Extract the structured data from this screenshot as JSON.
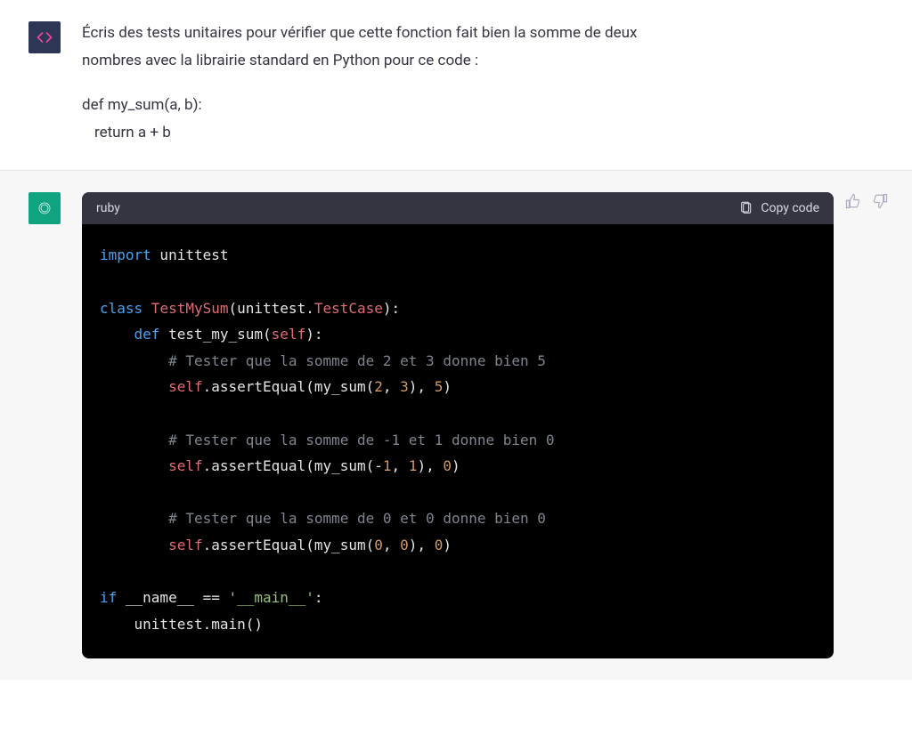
{
  "user_message": {
    "line1": "Écris des tests unitaires pour vérifier que cette fonction fait bien la somme de deux",
    "line2": "nombres avec la librairie standard en Python pour ce code :",
    "code_line1": "def my_sum(a, b):",
    "code_line2": "return a + b"
  },
  "assistant": {
    "code_header": {
      "language": "ruby",
      "copy_label": "Copy code"
    },
    "code": {
      "l1_import": "import",
      "l1_mod": " unittest",
      "l3_class": "class",
      "l3_name": " TestMySum",
      "l3_paren_a": "(unittest.",
      "l3_tc": "TestCase",
      "l3_paren_b": "):",
      "l4_def": "def",
      "l4_name": " test_my_sum",
      "l4_self_a": "(",
      "l4_self": "self",
      "l4_self_b": "):",
      "l5_cmt": "# Tester que la somme de 2 et 3 donne bien 5",
      "l6_self": "self",
      "l6_call": ".assertEqual(my_sum(",
      "l6_n1": "2",
      "l6_c": ", ",
      "l6_n2": "3",
      "l6_mid": "), ",
      "l6_n3": "5",
      "l6_end": ")",
      "l8_cmt": "# Tester que la somme de -1 et 1 donne bien 0",
      "l9_self": "self",
      "l9_call": ".assertEqual(my_sum(-",
      "l9_n1": "1",
      "l9_c": ", ",
      "l9_n2": "1",
      "l9_mid": "), ",
      "l9_n3": "0",
      "l9_end": ")",
      "l11_cmt": "# Tester que la somme de 0 et 0 donne bien 0",
      "l12_self": "self",
      "l12_call": ".assertEqual(my_sum(",
      "l12_n1": "0",
      "l12_c": ", ",
      "l12_n2": "0",
      "l12_mid": "), ",
      "l12_n3": "0",
      "l12_end": ")",
      "l14_if": "if",
      "l14_name": " __name__ == ",
      "l14_str": "'__main__'",
      "l14_colon": ":",
      "l15_call": "unittest.main()"
    }
  }
}
